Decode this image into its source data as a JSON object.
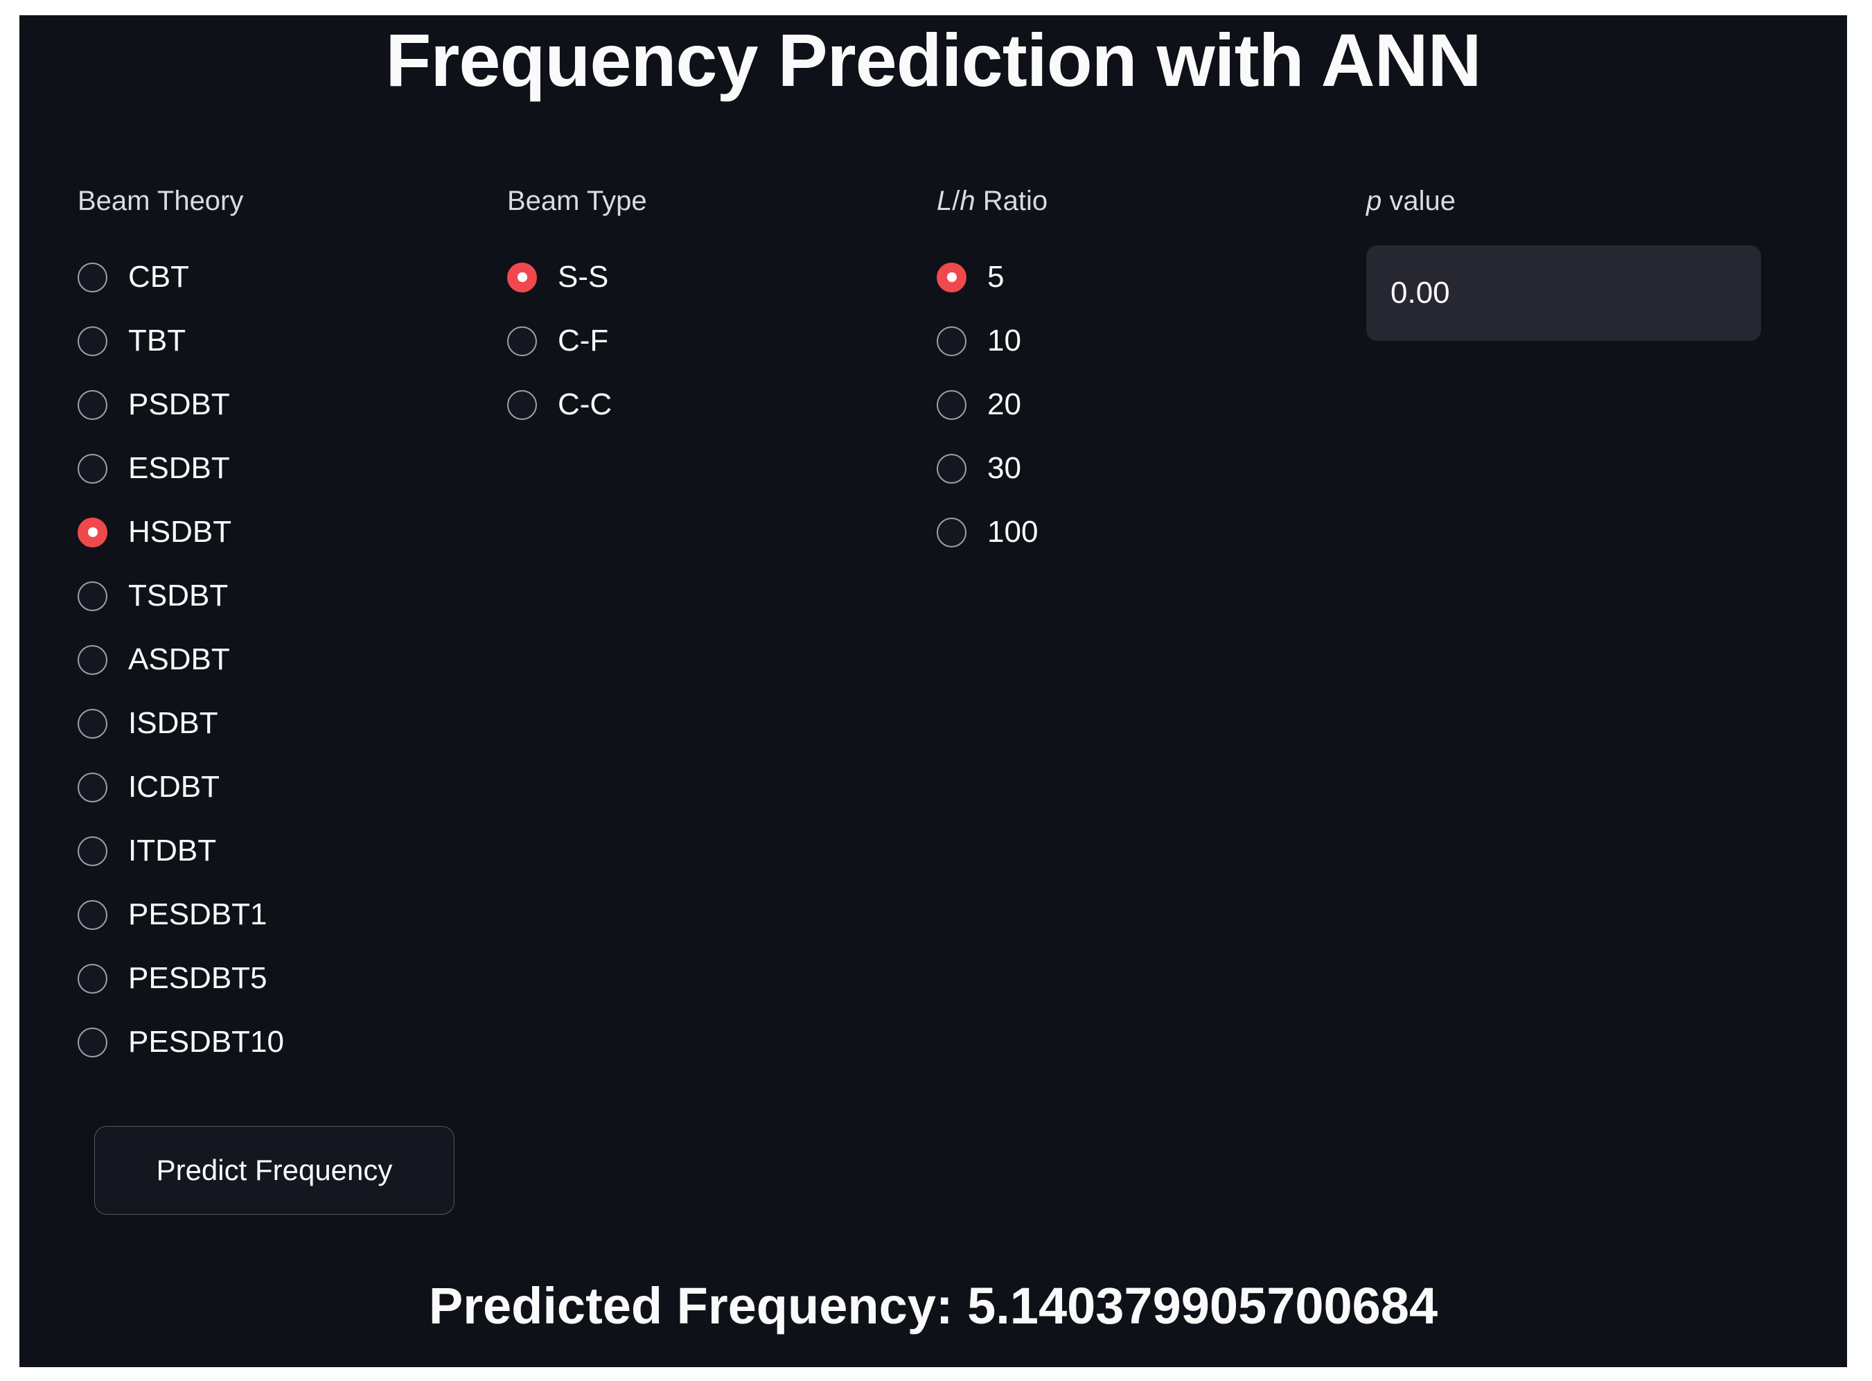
{
  "app": {
    "title": "Frequency Prediction with ANN",
    "panel_bg": "#0e1117",
    "accent": "#f0494d",
    "text_color": "#fafafa"
  },
  "beam_theory": {
    "label": "Beam Theory",
    "selected": "HSDBT",
    "options": [
      "CBT",
      "TBT",
      "PSDBT",
      "ESDBT",
      "HSDBT",
      "TSDBT",
      "ASDBT",
      "ISDBT",
      "ICDBT",
      "ITDBT",
      "PESDBT1",
      "PESDBT5",
      "PESDBT10"
    ]
  },
  "beam_type": {
    "label": "Beam Type",
    "selected": "S-S",
    "options": [
      "S-S",
      "C-F",
      "C-C"
    ]
  },
  "lh_ratio": {
    "label_italic_1": "L",
    "label_slash": "/",
    "label_italic_2": "h",
    "label_rest": " Ratio",
    "selected": "5",
    "options": [
      "5",
      "10",
      "20",
      "30",
      "100"
    ]
  },
  "p_value": {
    "label_italic": "p",
    "label_rest": " value",
    "value": "0.00",
    "placeholder": "0.00"
  },
  "actions": {
    "predict_label": "Predict Frequency"
  },
  "result": {
    "text": "Predicted Frequency: 5.140379905700684",
    "prefix": "Predicted Frequency: ",
    "value": "5.140379905700684"
  }
}
